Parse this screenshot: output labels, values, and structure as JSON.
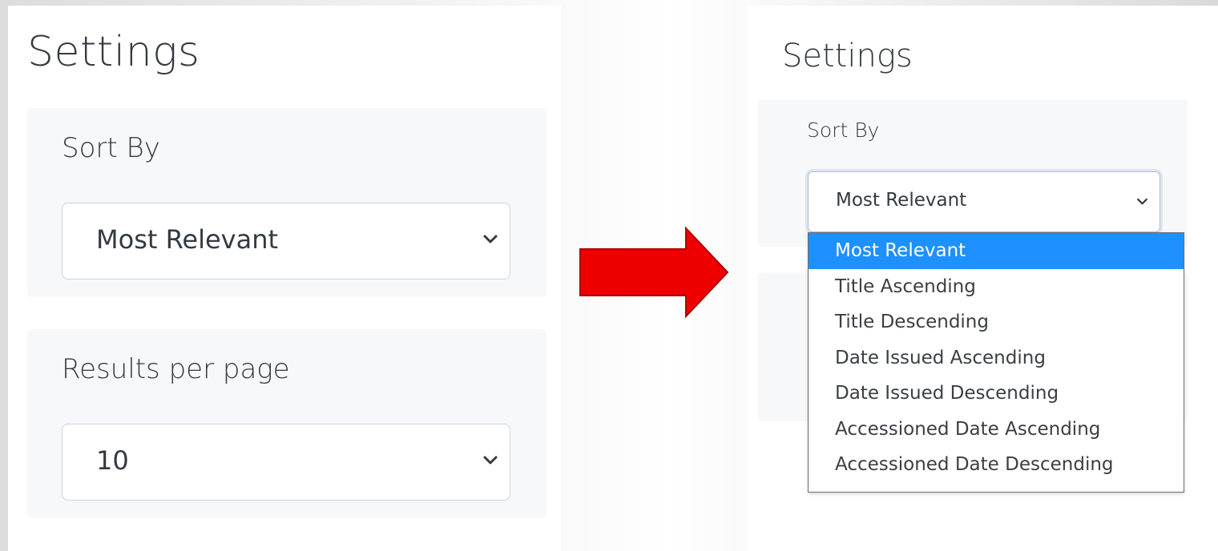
{
  "left": {
    "title": "Settings",
    "sort_label": "Sort By",
    "sort_value": "Most Relevant",
    "results_label": "Results per page",
    "results_value": "10"
  },
  "arrow": {
    "color": "#ee0000"
  },
  "right": {
    "title": "Settings",
    "sort_label": "Sort By",
    "sort_value": "Most Relevant",
    "dropdown_options": [
      "Most Relevant",
      "Title Ascending",
      "Title Descending",
      "Date Issued Ascending",
      "Date Issued Descending",
      "Accessioned Date Ascending",
      "Accessioned Date Descending"
    ],
    "selected_index": 0,
    "highlight_color": "#1e90ff"
  }
}
